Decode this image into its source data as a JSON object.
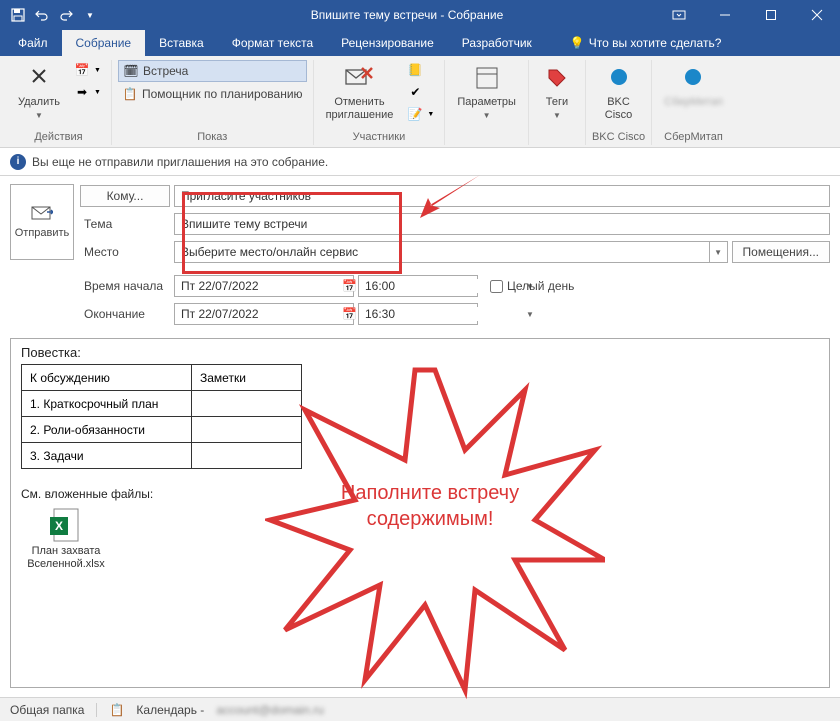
{
  "window": {
    "title": "Впишите тему встречи - Собрание"
  },
  "tabs": {
    "file": "Файл",
    "meeting": "Собрание",
    "insert": "Вставка",
    "format": "Формат текста",
    "review": "Рецензирование",
    "developer": "Разработчик",
    "tell": "Что вы хотите сделать?"
  },
  "ribbon": {
    "actions": {
      "delete": "Удалить",
      "group": "Действия"
    },
    "show": {
      "appointment": "Встреча",
      "scheduling": "Помощник по планированию",
      "group": "Показ"
    },
    "participants": {
      "cancel": "Отменить\nприглашение",
      "group": "Участники"
    },
    "options": {
      "label": "Параметры"
    },
    "tags": {
      "label": "Теги"
    },
    "bkc": {
      "label": "BKC\nCisco",
      "group": "BKC Cisco"
    },
    "sber": {
      "label": "",
      "group": "СберМитап"
    }
  },
  "banner": "Вы еще не отправили приглашения на это собрание.",
  "form": {
    "send": "Отправить",
    "to": "Кому...",
    "to_value": "Пригласите участников",
    "subject": "Тема",
    "subject_value": "Впишите тему встречи",
    "location": "Место",
    "location_value": "Выберите место/онлайн сервис",
    "rooms": "Помещения...",
    "start": "Время начала",
    "end": "Окончание",
    "start_date": "Пт 22/07/2022",
    "start_time": "16:00",
    "end_date": "Пт 22/07/2022",
    "end_time": "16:30",
    "allday": "Целый день"
  },
  "editor": {
    "agenda_title": "Повестка:",
    "col1": "К обсуждению",
    "col2": "Заметки",
    "row1": "1. Краткосрочный план",
    "row2": "2. Роли-обязанности",
    "row3": "3. Задачи",
    "attach_label": "См. вложенные файлы:",
    "attach_name": "План захвата Вселенной.xlsx"
  },
  "callout": "Наполните встречу содержимым!",
  "status": {
    "folder": "Общая папка",
    "calendar": "Календарь -"
  }
}
